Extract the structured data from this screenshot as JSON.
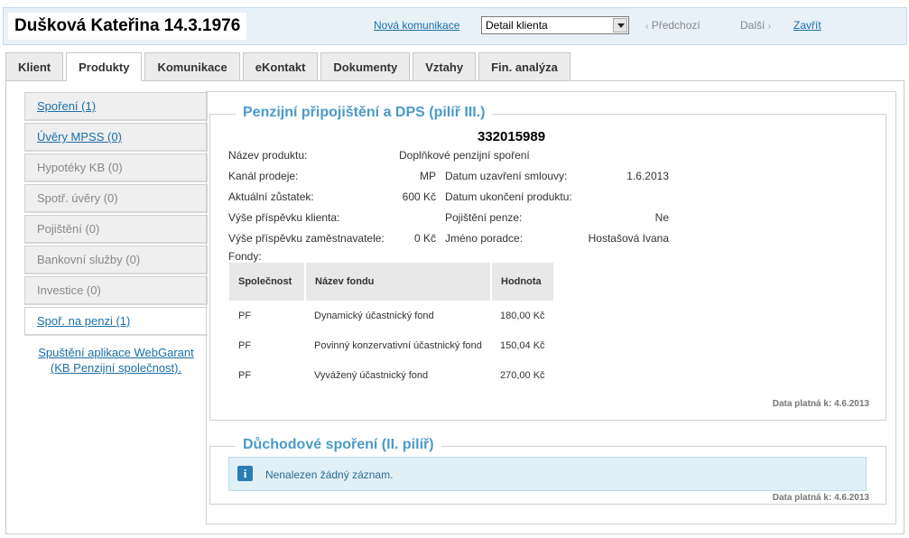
{
  "header": {
    "client_name": "Dušková Kateřina 14.3.1976",
    "new_communication": "Nová komunikace",
    "view_select": "Detail klienta",
    "prev": "Předchozí",
    "next": "Další",
    "close": "Zavřít"
  },
  "tabs": [
    "Klient",
    "Produkty",
    "Komunikace",
    "eKontakt",
    "Dokumenty",
    "Vztahy",
    "Fin. analýza"
  ],
  "active_tab": "Produkty",
  "sidebar": {
    "items": [
      {
        "label": "Spoření (1)",
        "state": "link"
      },
      {
        "label": "Úvěry MPSS (0)",
        "state": "link"
      },
      {
        "label": "Hypotéky KB (0)",
        "state": "disabled"
      },
      {
        "label": "Spotř. úvěry (0)",
        "state": "disabled"
      },
      {
        "label": "Pojištění (0)",
        "state": "disabled"
      },
      {
        "label": "Bankovní služby (0)",
        "state": "disabled"
      },
      {
        "label": "Investice (0)",
        "state": "disabled"
      },
      {
        "label": "Spoř. na penzi (1)",
        "state": "active"
      }
    ],
    "webgarant_line1": "Spuštění aplikace WebGarant",
    "webgarant_line2": "(KB Penzijní společnost)."
  },
  "pension": {
    "title": "Penzijní připojištění a DPS (pilíř III.)",
    "contract_number": "332015989",
    "product_name_label": "Název produktu:",
    "product_name_value": "Doplňkové penzijní spoření",
    "channel_label": "Kanál prodeje:",
    "channel_value": "MP",
    "contract_date_label": "Datum uzavření smlouvy:",
    "contract_date_value": "1.6.2013",
    "balance_label": "Aktuální zůstatek:",
    "balance_value": "600 Kč",
    "end_date_label": "Datum ukončení produktu:",
    "end_date_value": "",
    "client_contrib_label": "Výše příspěvku klienta:",
    "client_contrib_value": "",
    "pension_insurance_label": "Pojištění penze:",
    "pension_insurance_value": "Ne",
    "employer_contrib_label": "Výše příspěvku zaměstnavatele:",
    "employer_contrib_value": "0 Kč",
    "advisor_label": "Jméno poradce:",
    "advisor_value": "Hostašová Ivana",
    "funds_label": "Fondy:",
    "funds_columns": [
      "Společnost",
      "Název fondu",
      "Hodnota"
    ],
    "funds_rows": [
      [
        "PF",
        "Dynamický účastnický fond",
        "180,00 Kč"
      ],
      [
        "PF",
        "Povinný konzervativní účastnický fond",
        "150,04 Kč"
      ],
      [
        "PF",
        "Vyvážený účastnický fond",
        "270,00 Kč"
      ]
    ],
    "valid_as_of": "Data platná k: 4.6.2013"
  },
  "retirement": {
    "title": "Důchodové spoření (II. pilíř)",
    "no_record": "Nenalezen žádný záznam.",
    "valid_as_of": "Data platná k: 4.6.2013"
  },
  "colors": {
    "accent_blue": "#4a9bc9",
    "link_blue": "#1a6fa8",
    "info_bg": "#e1f0f7",
    "header_bg": "#e8f1f8"
  }
}
